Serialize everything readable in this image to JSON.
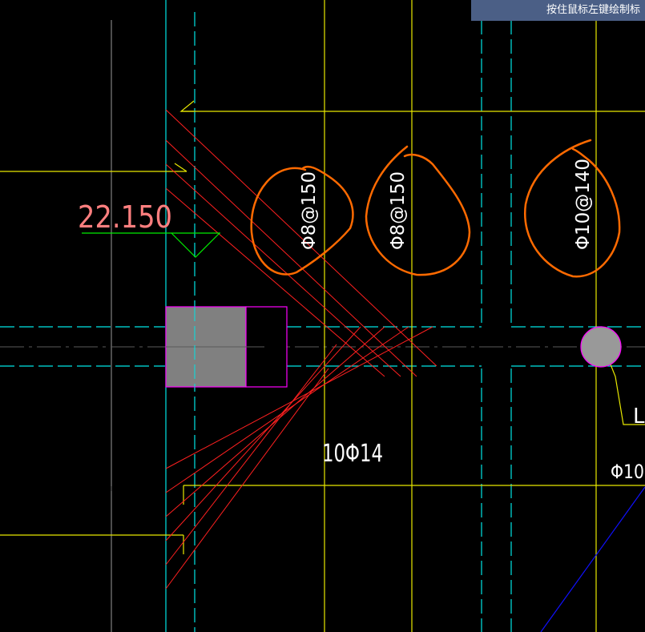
{
  "status_hint": "按住鼠标左键绘制标",
  "elevation_label": "22.150",
  "rebar_labels": {
    "stirrup_1": "Φ8@150",
    "stirrup_2": "Φ8@150",
    "stirrup_3": "Φ10@140",
    "main_bars": "10Φ14",
    "edge_bar": "Φ10",
    "leader_tag": "L"
  },
  "colors": {
    "background": "#000000",
    "axis_cyan": "#00ffff",
    "line_yellow": "#ffff00",
    "rebar_red": "#ff2020",
    "column_magenta": "#ff00ff",
    "column_fill": "#808080",
    "annotation_orange": "#ff6a00",
    "elevation_pink": "#ff7f7f",
    "marker_green": "#00ff00",
    "grid_gray": "#a0a0a0",
    "blue_line": "#1010ff",
    "hint_bar": "#4b5f86"
  }
}
